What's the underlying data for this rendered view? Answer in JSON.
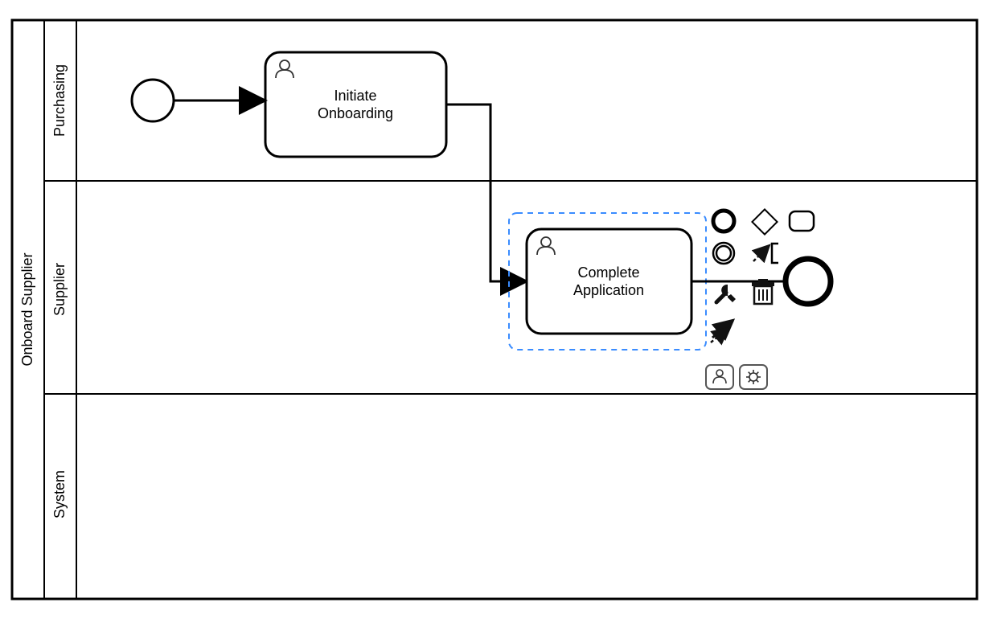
{
  "pool": {
    "title": "Onboard Supplier"
  },
  "lanes": [
    {
      "id": "purchasing",
      "label": "Purchasing"
    },
    {
      "id": "supplier",
      "label": "Supplier"
    },
    {
      "id": "system",
      "label": "System"
    }
  ],
  "tasks": {
    "initiate": {
      "label_line1": "Initiate",
      "label_line2": "Onboarding"
    },
    "complete": {
      "label_line1": "Complete",
      "label_line2": "Application"
    }
  },
  "events": {
    "start": {
      "type": "start-event"
    },
    "end": {
      "type": "end-event"
    }
  },
  "selected_element": "complete",
  "context_pad": {
    "items": [
      "start-event-tool",
      "gateway-tool",
      "task-tool",
      "intermediate-event-tool",
      "text-annotation-tool",
      "end-event-tool",
      "wrench-tool",
      "trash-tool",
      "sequence-flow-tool"
    ],
    "markers": [
      "user-task-marker",
      "service-task-marker"
    ]
  }
}
